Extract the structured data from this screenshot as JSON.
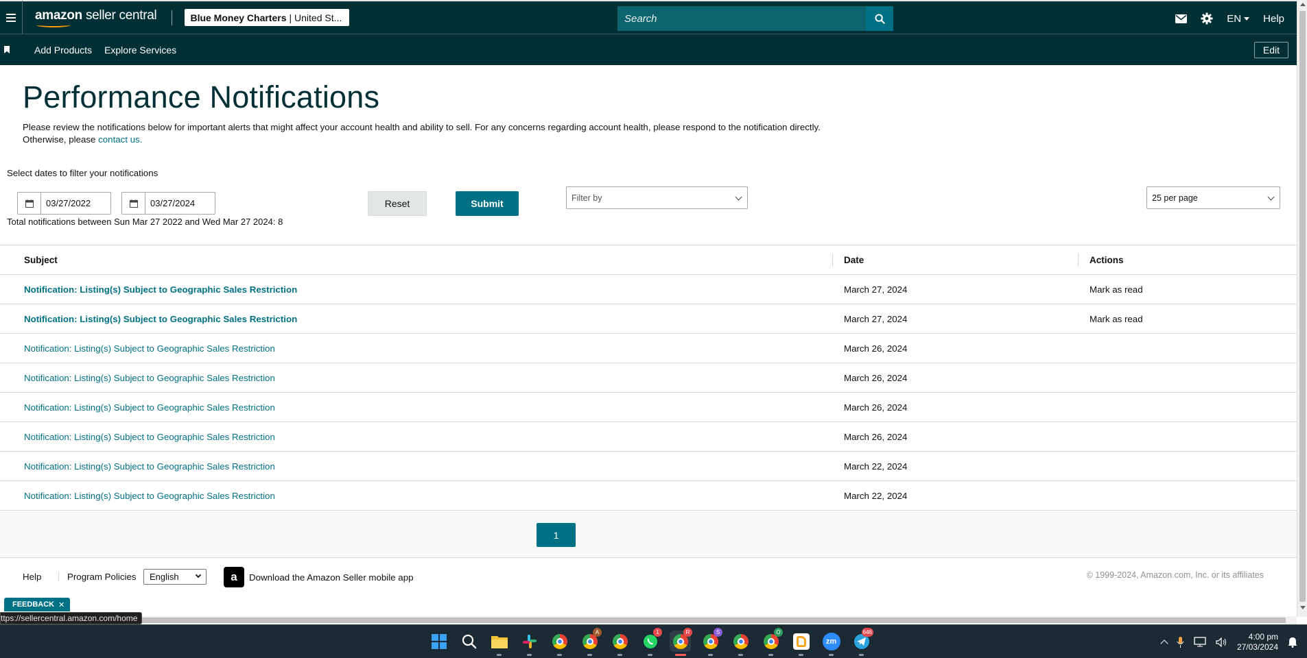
{
  "topbar": {
    "logo_brand": "amazon",
    "logo_product": "seller central",
    "account_name": "Blue Money Charters",
    "account_region": "| United St...",
    "search_placeholder": "Search",
    "language": "EN",
    "help": "Help",
    "colors": {
      "bg": "#002f36",
      "search": "#0d646f",
      "accent": "#007185"
    }
  },
  "subnav": {
    "items": [
      "Add Products",
      "Explore Services"
    ],
    "edit": "Edit"
  },
  "page": {
    "title": "Performance Notifications",
    "intro_text": "Please review the notifications below for important alerts that might affect your account health and ability to sell. For any concerns regarding account health, please respond to the notification directly. Otherwise, please",
    "contact_link": "contact us.",
    "filter_label": "Select dates to filter your notifications",
    "start_date": "03/27/2022",
    "end_date": "03/27/2024",
    "total_text": "Total notifications between Sun Mar 27 2022 and Wed Mar 27 2024: 8",
    "reset": "Reset",
    "submit": "Submit",
    "filter_by_placeholder": "Filter by",
    "per_page": "25 per page"
  },
  "table": {
    "headers": {
      "subject": "Subject",
      "date": "Date",
      "actions": "Actions"
    },
    "rows": [
      {
        "subject": "Notification: Listing(s) Subject to Geographic Sales Restriction",
        "date": "March 27, 2024",
        "action": "Mark as read",
        "unread": true
      },
      {
        "subject": "Notification: Listing(s) Subject to Geographic Sales Restriction",
        "date": "March 27, 2024",
        "action": "Mark as read",
        "unread": true
      },
      {
        "subject": "Notification: Listing(s) Subject to Geographic Sales Restriction",
        "date": "March 26, 2024",
        "action": "",
        "unread": false
      },
      {
        "subject": "Notification: Listing(s) Subject to Geographic Sales Restriction",
        "date": "March 26, 2024",
        "action": "",
        "unread": false
      },
      {
        "subject": "Notification: Listing(s) Subject to Geographic Sales Restriction",
        "date": "March 26, 2024",
        "action": "",
        "unread": false
      },
      {
        "subject": "Notification: Listing(s) Subject to Geographic Sales Restriction",
        "date": "March 26, 2024",
        "action": "",
        "unread": false
      },
      {
        "subject": "Notification: Listing(s) Subject to Geographic Sales Restriction",
        "date": "March 22, 2024",
        "action": "",
        "unread": false
      },
      {
        "subject": "Notification: Listing(s) Subject to Geographic Sales Restriction",
        "date": "March 22, 2024",
        "action": "",
        "unread": false
      }
    ]
  },
  "pagination": {
    "current": "1"
  },
  "footer": {
    "help": "Help",
    "policies": "Program Policies",
    "language": "English",
    "app_icon_letter": "a",
    "app_text": "Download the Amazon Seller mobile app",
    "copyright": "© 1999-2024, Amazon.com, Inc. or its affiliates"
  },
  "feedback": {
    "label": "FEEDBACK",
    "close": "✕"
  },
  "status_url": "ttps://sellercentral.amazon.com/home",
  "taskbar": {
    "icons": [
      {
        "name": "windows-start-icon"
      },
      {
        "name": "search-icon"
      },
      {
        "name": "file-explorer-icon"
      },
      {
        "name": "slack-icon"
      },
      {
        "name": "chrome-icon",
        "badge": ""
      },
      {
        "name": "chrome-profile-a-icon",
        "badge": "A"
      },
      {
        "name": "chrome-icon-2",
        "badge": ""
      },
      {
        "name": "whatsapp-icon",
        "badge": "1"
      },
      {
        "name": "chrome-profile-r-icon",
        "badge": "R",
        "active": true
      },
      {
        "name": "chrome-profile-s-icon",
        "badge": "S"
      },
      {
        "name": "chrome-icon-3",
        "badge": ""
      },
      {
        "name": "chrome-profile-o-icon",
        "badge": "O"
      },
      {
        "name": "rakuten-icon",
        "badge": ""
      },
      {
        "name": "zoom-icon",
        "badge": ""
      },
      {
        "name": "telegram-icon",
        "badge": "646"
      }
    ],
    "time": "4:00 pm",
    "date": "27/03/2024"
  }
}
